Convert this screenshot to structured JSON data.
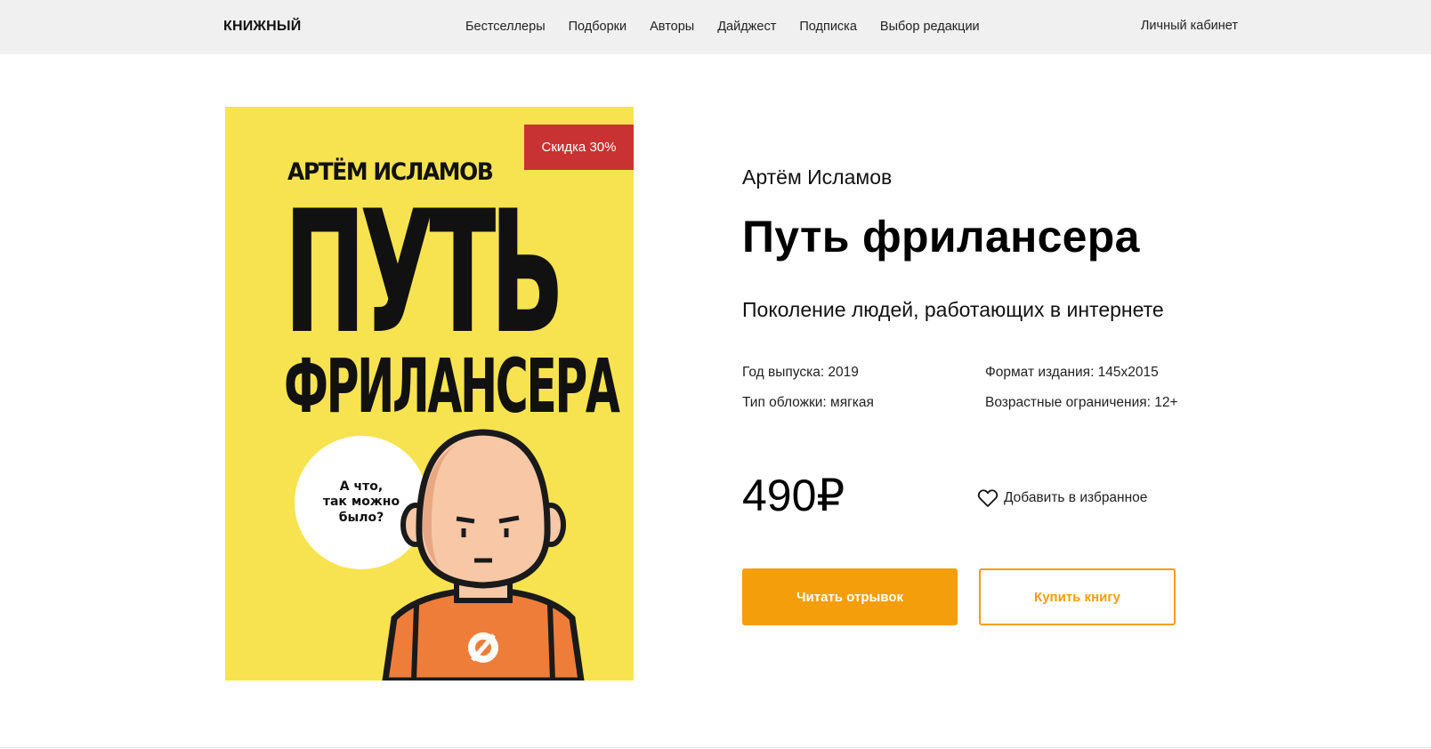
{
  "header": {
    "logo": "КНИЖНЫЙ",
    "nav": [
      "Бестселлеры",
      "Подборки",
      "Авторы",
      "Дайджест",
      "Подписка",
      "Выбор редакции"
    ],
    "account": "Личный кабинет"
  },
  "cover": {
    "discount": "Скидка 30%",
    "author": "АРТЁМ ИСЛАМОВ",
    "title_line1": "ПУТЬ",
    "title_line2": "ФРИЛАНСЕРА",
    "bubble": "А что,\nтак можно\nбыло?"
  },
  "book": {
    "author": "Артём Исламов",
    "title": "Путь фрилансера",
    "subtitle": "Поколение людей, работающих в интернете",
    "year": "Год выпуска: 2019",
    "format": "Формат издания: 145x2015",
    "cover_type": "Тип обложки: мягкая",
    "age": "Возрастные ограничения: 12+",
    "price": "490₽",
    "favorite_label": "Добавить в избранное",
    "read_label": "Читать отрывок",
    "buy_label": "Купить книгу"
  },
  "colors": {
    "accent": "#f59e0b",
    "discount": "#c93232",
    "cover_bg": "#f7e34f",
    "header_bg": "#f0f0f0"
  }
}
